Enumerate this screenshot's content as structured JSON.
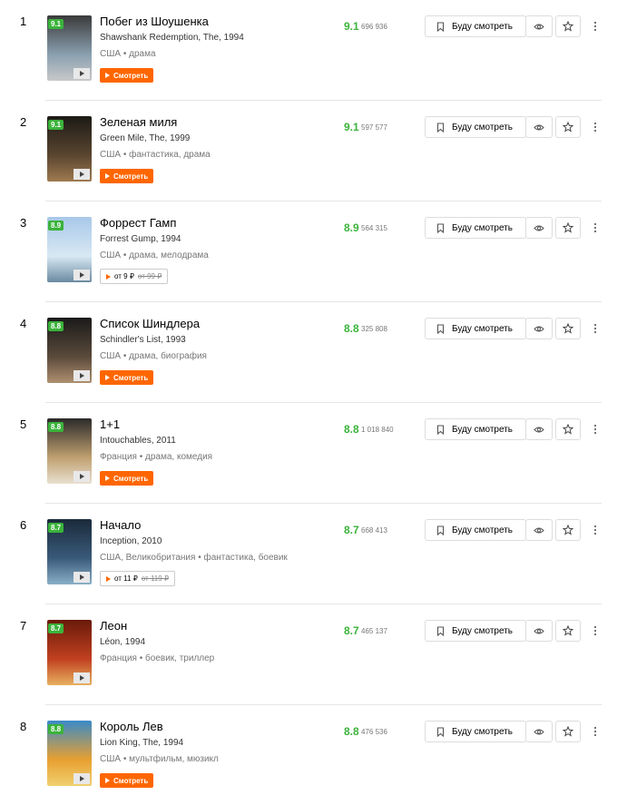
{
  "ui": {
    "future_label": "Буду смотреть",
    "watch_label": "Смотреть"
  },
  "colors": {
    "rating_green": "#3bb33b",
    "accent_orange": "#ff6600"
  },
  "movies": [
    {
      "rank": "1",
      "title": "Побег из Шоушенка",
      "original": "Shawshank Redemption, The, 1994",
      "meta": "США • драма",
      "rating": "9.1",
      "votes": "696 936",
      "badge": "9.1",
      "action": "watch",
      "price": "",
      "old_price": "",
      "poster_colors": [
        "#3a3a3a",
        "#8aa0b0",
        "#c8c8c8"
      ]
    },
    {
      "rank": "2",
      "title": "Зеленая миля",
      "original": "Green Mile, The, 1999",
      "meta": "США • фантастика, драма",
      "rating": "9.1",
      "votes": "597 577",
      "badge": "9.1",
      "action": "watch",
      "price": "",
      "old_price": "",
      "poster_colors": [
        "#1c1a16",
        "#5a4630",
        "#a07a50"
      ]
    },
    {
      "rank": "3",
      "title": "Форрест Гамп",
      "original": "Forrest Gump, 1994",
      "meta": "США • драма, мелодрама",
      "rating": "8.9",
      "votes": "564 315",
      "badge": "8.9",
      "action": "price",
      "price": "от 9 ₽",
      "old_price": "от 99 ₽",
      "poster_colors": [
        "#a8c8e8",
        "#d8e8f4",
        "#6a8aa0"
      ]
    },
    {
      "rank": "4",
      "title": "Список Шиндлера",
      "original": "Schindler's List, 1993",
      "meta": "США • драма, биография",
      "rating": "8.8",
      "votes": "325 808",
      "badge": "8.8",
      "action": "watch",
      "price": "",
      "old_price": "",
      "poster_colors": [
        "#1a1a1a",
        "#5a4a3a",
        "#b09070"
      ]
    },
    {
      "rank": "5",
      "title": "1+1",
      "original": "Intouchables, 2011",
      "meta": "Франция • драма, комедия",
      "rating": "8.8",
      "votes": "1 018 840",
      "badge": "8.8",
      "action": "watch",
      "price": "",
      "old_price": "",
      "poster_colors": [
        "#2a2a2a",
        "#c0a070",
        "#e8e0d0"
      ]
    },
    {
      "rank": "6",
      "title": "Начало",
      "original": "Inception, 2010",
      "meta": "США, Великобритания • фантастика, боевик",
      "rating": "8.7",
      "votes": "668 413",
      "badge": "8.7",
      "action": "price",
      "price": "от 11 ₽",
      "old_price": "от 119 ₽",
      "poster_colors": [
        "#1a2a3a",
        "#3a5a7a",
        "#8ab0c8"
      ]
    },
    {
      "rank": "7",
      "title": "Леон",
      "original": "Léon, 1994",
      "meta": "Франция • боевик, триллер",
      "rating": "8.7",
      "votes": "465 137",
      "badge": "8.7",
      "action": "none",
      "price": "",
      "old_price": "",
      "poster_colors": [
        "#6a1a0a",
        "#c04020",
        "#e8b060"
      ]
    },
    {
      "rank": "8",
      "title": "Король Лев",
      "original": "Lion King, The, 1994",
      "meta": "США • мультфильм, мюзикл",
      "rating": "8.8",
      "votes": "476 536",
      "badge": "8.8",
      "action": "watch",
      "price": "",
      "old_price": "",
      "poster_colors": [
        "#3a8ac8",
        "#e8a030",
        "#f0d070"
      ]
    }
  ]
}
